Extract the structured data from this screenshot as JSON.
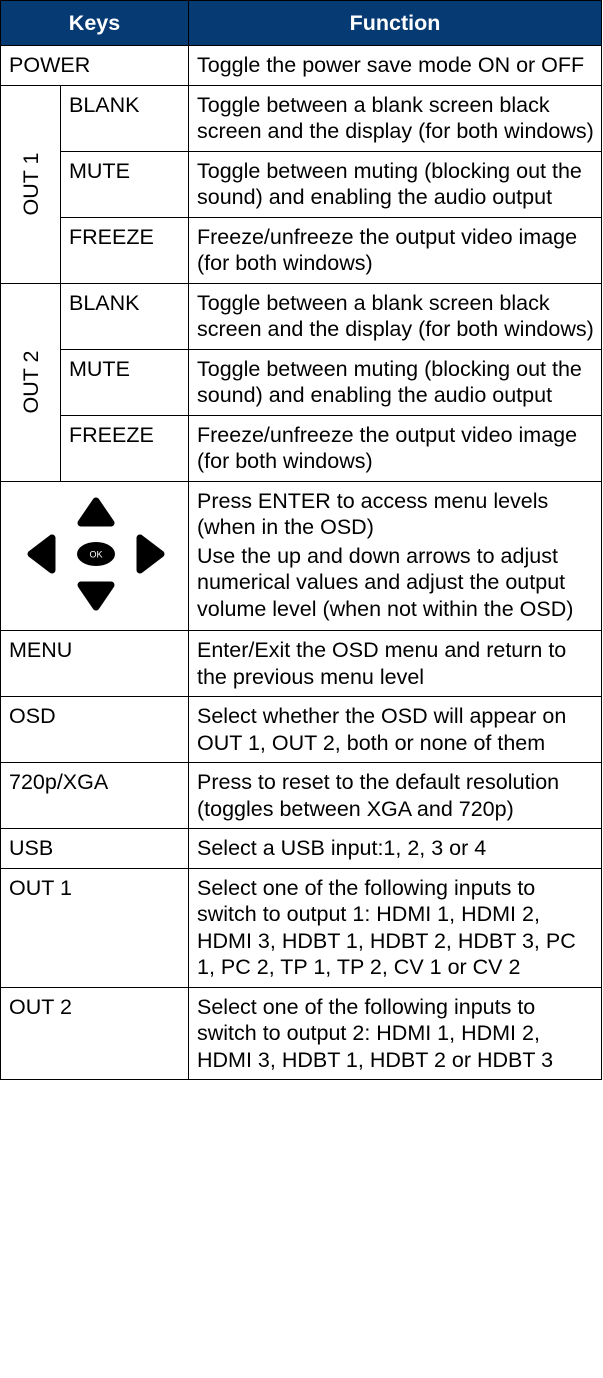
{
  "headers": {
    "keys": "Keys",
    "function": "Function"
  },
  "power": {
    "key": "POWER",
    "function": "Toggle the power save mode ON or OFF"
  },
  "out1_group": {
    "label": "OUT 1",
    "rows": [
      {
        "key": "BLANK",
        "function": "Toggle between a blank screen black screen and the display (for both windows)"
      },
      {
        "key": "MUTE",
        "function": "Toggle between muting (blocking out the sound) and enabling the audio output"
      },
      {
        "key": "FREEZE",
        "function": "Freeze/unfreeze the output video image (for both windows)"
      }
    ]
  },
  "out2_group": {
    "label": "OUT 2",
    "rows": [
      {
        "key": "BLANK",
        "function": "Toggle between a blank screen black screen and the display (for both windows)"
      },
      {
        "key": "MUTE",
        "function": "Toggle between muting (blocking out the sound) and enabling the audio output"
      },
      {
        "key": "FREEZE",
        "function": "Freeze/unfreeze the output video image (for both windows)"
      }
    ]
  },
  "nav": {
    "ok_label": "OK",
    "function_1": "Press ENTER to access menu levels (when in the OSD)",
    "function_2": "Use the up and down arrows to adjust numerical values and adjust the output volume level (when not within the OSD)"
  },
  "rows": [
    {
      "key": "MENU",
      "function": "Enter/Exit the OSD menu and return to the previous menu level"
    },
    {
      "key": "OSD",
      "function": "Select whether the OSD will appear on OUT 1, OUT 2, both or none of them"
    },
    {
      "key": "720p/XGA",
      "function": "Press to reset to the default resolution (toggles between XGA and 720p)"
    },
    {
      "key": "USB",
      "function": "Select a USB input:1, 2, 3 or 4"
    },
    {
      "key": "OUT 1",
      "function": "Select one of the following inputs to switch to output 1: HDMI 1, HDMI 2, HDMI 3, HDBT 1, HDBT 2, HDBT 3, PC 1, PC 2, TP 1, TP 2, CV 1 or CV 2"
    },
    {
      "key": "OUT 2",
      "function": "Select one of the following inputs to switch to output 2: HDMI 1, HDMI 2, HDMI 3, HDBT 1, HDBT 2 or HDBT 3"
    }
  ],
  "colors": {
    "header_bg": "#053a73",
    "header_text": "#ffffff",
    "border": "#000000"
  },
  "icons": [
    "up-arrow-icon",
    "down-arrow-icon",
    "left-arrow-icon",
    "right-arrow-icon",
    "ok-button-icon"
  ]
}
